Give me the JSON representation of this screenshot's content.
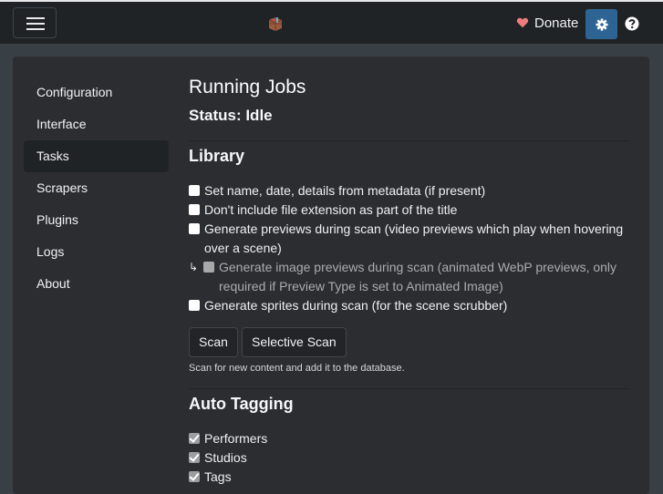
{
  "navbar": {
    "menu_icon": "hamburger-menu-icon",
    "logo_icon": "box-logo-icon",
    "donate_label": "Donate",
    "donate_icon": "heart-icon",
    "settings_icon": "gear-icon",
    "help_icon": "question-circle-icon",
    "accent_color": "#2e6494",
    "heart_color": "#f07d7d"
  },
  "sidebar": {
    "items": [
      {
        "label": "Configuration",
        "active": false
      },
      {
        "label": "Interface",
        "active": false
      },
      {
        "label": "Tasks",
        "active": true
      },
      {
        "label": "Scrapers",
        "active": false
      },
      {
        "label": "Plugins",
        "active": false
      },
      {
        "label": "Logs",
        "active": false
      },
      {
        "label": "About",
        "active": false
      }
    ]
  },
  "main": {
    "title": "Running Jobs",
    "status": "Status: Idle",
    "library": {
      "heading": "Library",
      "options": [
        {
          "label": "Set name, date, details from metadata (if present)",
          "checked": false,
          "disabled": false
        },
        {
          "label": "Don't include file extension as part of the title",
          "checked": false,
          "disabled": false
        },
        {
          "label": "Generate previews during scan (video previews which play when hovering over a scene)",
          "checked": false,
          "disabled": false
        },
        {
          "label": "Generate image previews during scan (animated WebP previews, only required if Preview Type is set to Animated Image)",
          "checked": false,
          "disabled": true,
          "indent_icon": "↳"
        },
        {
          "label": "Generate sprites during scan (for the scene scrubber)",
          "checked": false,
          "disabled": false
        }
      ],
      "scan_button": "Scan",
      "selective_scan_button": "Selective Scan",
      "hint": "Scan for new content and add it to the database."
    },
    "auto_tagging": {
      "heading": "Auto Tagging",
      "options": [
        {
          "label": "Performers",
          "checked": true
        },
        {
          "label": "Studios",
          "checked": true
        },
        {
          "label": "Tags",
          "checked": true
        }
      ]
    }
  }
}
